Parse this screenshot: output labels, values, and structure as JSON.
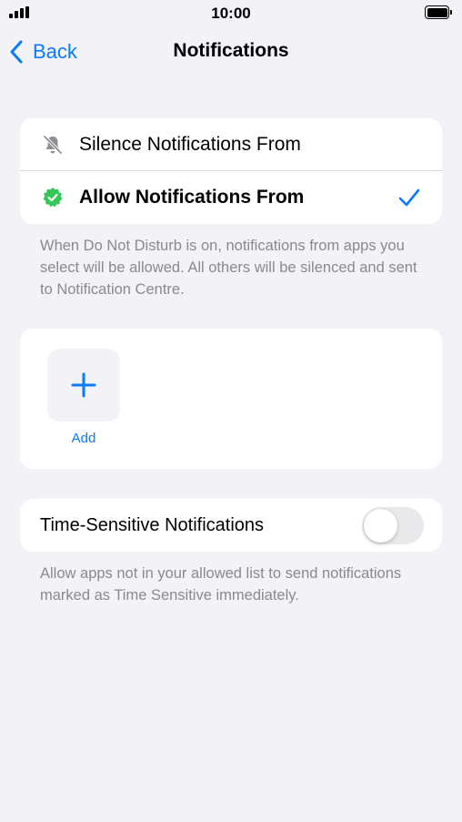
{
  "status_bar": {
    "time": "10:00",
    "battery_level": 0.9,
    "signal_bars": 4
  },
  "nav": {
    "back_label": "Back",
    "title": "Notifications"
  },
  "mode_options": {
    "items": [
      {
        "label": "Silence Notifications From",
        "icon": "bell-slash-icon",
        "selected": false
      },
      {
        "label": "Allow Notifications From",
        "icon": "checkmark-seal-icon",
        "selected": true
      }
    ],
    "footnote": "When Do Not Disturb is on, notifications from apps you select will be allowed. All others will be silenced and sent to Notification Centre."
  },
  "apps": {
    "add_label": "Add",
    "add_icon": "plus-icon"
  },
  "time_sensitive": {
    "label": "Time-Sensitive Notifications",
    "enabled": false,
    "footnote": "Allow apps not in your allowed list to send notifications marked as Time Sensitive immediately."
  },
  "colors": {
    "accent": "#0a7aff",
    "check_green": "#34c759",
    "background": "#f2f2f7"
  }
}
